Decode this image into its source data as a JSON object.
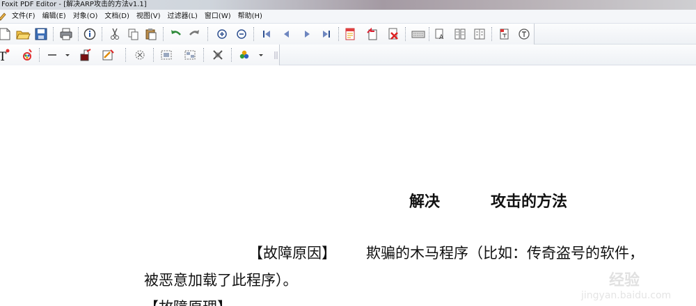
{
  "window": {
    "title": "Foxit PDF Editor - [解决ARP攻击的方法v1.1]"
  },
  "menu": [
    {
      "id": "file",
      "label": "文件(F)"
    },
    {
      "id": "edit",
      "label": "编辑(E)"
    },
    {
      "id": "object",
      "label": "对象(O)"
    },
    {
      "id": "document",
      "label": "文档(D)"
    },
    {
      "id": "view",
      "label": "视图(V)"
    },
    {
      "id": "filter",
      "label": "过滤器(L)"
    },
    {
      "id": "window",
      "label": "窗口(W)"
    },
    {
      "id": "help",
      "label": "帮助(H)"
    }
  ],
  "toolbar1_icons": [
    "new-file-icon",
    "open-folder-icon",
    "save-icon",
    "print-icon",
    "info-icon",
    "cut-icon",
    "copy-icon",
    "paste-icon",
    "undo-icon",
    "redo-icon",
    "zoom-in-icon",
    "zoom-out-icon",
    "first-page-icon",
    "previous-page-icon",
    "next-page-icon",
    "last-page-icon",
    "page-properties-icon",
    "insert-page-icon",
    "delete-page-icon",
    "keyboard-icon",
    "text-fit-icon",
    "columns-icon",
    "split-icon",
    "page-text-icon",
    "help-circle-icon"
  ],
  "toolbar2_icons": [
    "text-tool-icon",
    "color-tool-icon",
    "line-tool-icon",
    "dropdown-arrow-icon",
    "image-tool-icon",
    "shape-tool-icon",
    "select-object-icon",
    "group-objects-icon",
    "ungroup-objects-icon",
    "delete-object-icon",
    "colorize-icon",
    "dropdown-arrow-icon",
    "more-icon"
  ],
  "document": {
    "heading": {
      "part1": "解决",
      "part2": "攻击的方法"
    },
    "para1": {
      "label": "【故障原因】",
      "text": "欺骗的木马程序（比如：传奇盗号的软件，"
    },
    "para2": "被恶意加载了此程序）。",
    "para3": "【故障原理】"
  },
  "watermark": {
    "brand": "经验",
    "url": "jingyan.baidu.com"
  }
}
